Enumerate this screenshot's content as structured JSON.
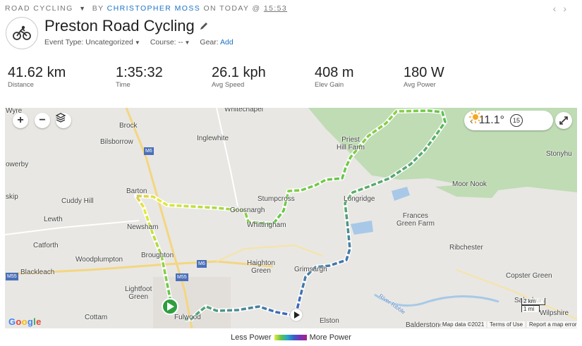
{
  "breadcrumb": {
    "activity_type": "ROAD CYCLING",
    "by": "BY",
    "author": "CHRISTOPHER MOSS",
    "on": "ON TODAY @",
    "time": "15:53"
  },
  "nav": {
    "prev": "‹",
    "next": "›"
  },
  "activity": {
    "title": "Preston Road Cycling",
    "event_type_label": "Event Type: Uncategorized",
    "course_label": "Course: --",
    "gear_label": "Gear:",
    "gear_add": "Add"
  },
  "stats": [
    {
      "value": "41.62 km",
      "label": "Distance"
    },
    {
      "value": "1:35:32",
      "label": "Time"
    },
    {
      "value": "26.1 kph",
      "label": "Avg Speed"
    },
    {
      "value": "408 m",
      "label": "Elev Gain"
    },
    {
      "value": "180 W",
      "label": "Avg Power"
    }
  ],
  "map": {
    "zoom_in": "+",
    "zoom_out": "−",
    "weather_temp": "11.1°",
    "weather_wind": "15",
    "places": {
      "whitechapel": "Whitechapel",
      "wyre": "Wyre",
      "brock": "Brock",
      "bilsborrow": "Bilsborrow",
      "inglewhite": "Inglewhite",
      "priest_hill_farm": "Priest\nHill Farm",
      "stonyhu": "Stonyhu",
      "owerby": "owerby",
      "moor_nook": "Moor Nook",
      "skip": "skip",
      "barton": "Barton",
      "cuddy_hill": "Cuddy Hill",
      "stumpcross": "Stumpcross",
      "goosnargh": "Goosnargh",
      "longridge": "Longridge",
      "lewth": "Lewth",
      "whittingham": "Whittingham",
      "frances_green_farm": "Frances\nGreen Farm",
      "newsham": "Newsham",
      "catforth": "Catforth",
      "ribchester": "Ribchester",
      "broughton": "Broughton",
      "woodplumpton": "Woodplumpton",
      "blackleach": "Blackleach",
      "haighton_green": "Haighton\nGreen",
      "grimsargh": "Grimsargh",
      "copster_green": "Copster Green",
      "lightfoot_green": "Lightfoot\nGreen",
      "salesbury": "Salesbury",
      "cottam": "Cottam",
      "fulwood": "Fulwood",
      "elston": "Elston",
      "balderstone": "Balderstone",
      "wilpshire": "Wilpshire",
      "m6": "M6",
      "m55": "M55",
      "river_ribble": "River Ribble"
    },
    "google": "Google",
    "map_data": "Map data ©2021",
    "terms": "Terms of Use",
    "report": "Report a map error",
    "scale_km": "2 km",
    "scale_mi": "1 mi"
  },
  "legend": {
    "less": "Less Power",
    "more": "More Power"
  },
  "colors": {
    "accent": "#1a74c7",
    "start": "#2e9e3e",
    "park": "#bfdcb4",
    "water": "#a8c8e8",
    "road": "#f4d680"
  }
}
